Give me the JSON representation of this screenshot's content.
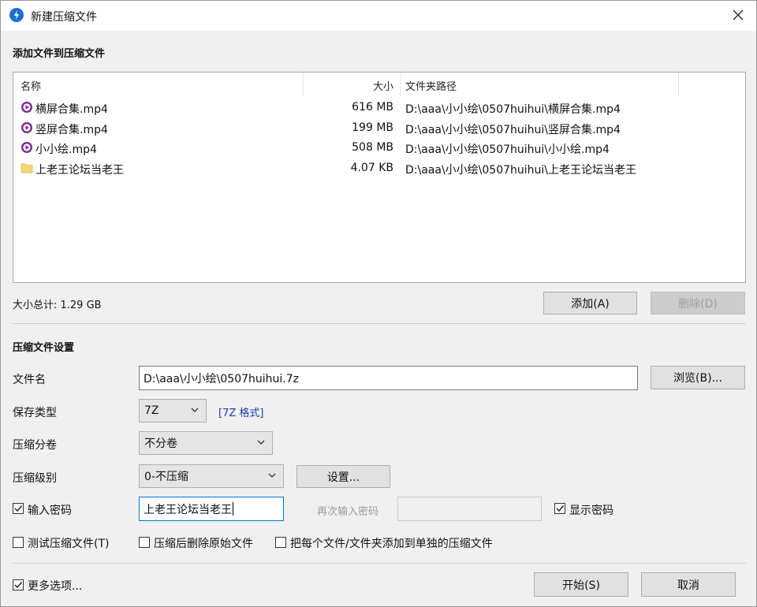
{
  "window": {
    "title": "新建压缩文件",
    "close_glyph": "✕"
  },
  "add_section": {
    "title": "添加文件到压缩文件"
  },
  "file_list": {
    "columns": [
      "名称",
      "大小",
      "文件夹路径"
    ],
    "rows": [
      {
        "name": "横屏合集.mp4",
        "size": "616 MB",
        "path": "D:\\aaa\\小小绘\\0507huihui\\横屏合集.mp4",
        "icon": "video-file-icon"
      },
      {
        "name": "竖屏合集.mp4",
        "size": "199 MB",
        "path": "D:\\aaa\\小小绘\\0507huihui\\竖屏合集.mp4",
        "icon": "video-file-icon"
      },
      {
        "name": "小小绘.mp4",
        "size": "508 MB",
        "path": "D:\\aaa\\小小绘\\0507huihui\\小小绘.mp4",
        "icon": "video-file-icon"
      },
      {
        "name": "上老王论坛当老王",
        "size": "4.07 KB",
        "path": "D:\\aaa\\小小绘\\0507huihui\\上老王论坛当老王",
        "icon": "folder-icon"
      }
    ]
  },
  "total_size": "大小总计: 1.29 GB",
  "buttons": {
    "add": "添加(A)",
    "delete": "删除(D)",
    "browse": "浏览(B)...",
    "settings": "设置...",
    "start": "开始(S)",
    "cancel": "取消"
  },
  "settings_section": {
    "title": "压缩文件设置",
    "filename_label": "文件名",
    "filename_value": "D:\\aaa\\小小绘\\0507huihui.7z",
    "save_type_label": "保存类型",
    "save_type_value": "7Z",
    "format_link": "[7Z 格式]",
    "split_label": "压缩分卷",
    "split_value": "不分卷",
    "level_label": "压缩级别",
    "level_value": "0-不压缩",
    "password_label": "输入密码",
    "password_checked": true,
    "password_value": "上老王论坛当老王",
    "reenter_label": "再次输入密码",
    "show_password_label": "显示密码",
    "show_password_checked": true,
    "test_label": "测试压缩文件(T)",
    "test_checked": false,
    "delete_after_label": "压缩后删除原始文件",
    "delete_after_checked": false,
    "each_separate_label": "把每个文件/文件夹添加到单独的压缩文件",
    "each_separate_checked": false,
    "more_options_label": "更多选项...",
    "more_options_checked": true
  },
  "colors": {
    "accent": "#0078d7",
    "video_icon": "#7b2a8e",
    "folder_icon": "#f7d774",
    "link": "#1a3ea8"
  }
}
